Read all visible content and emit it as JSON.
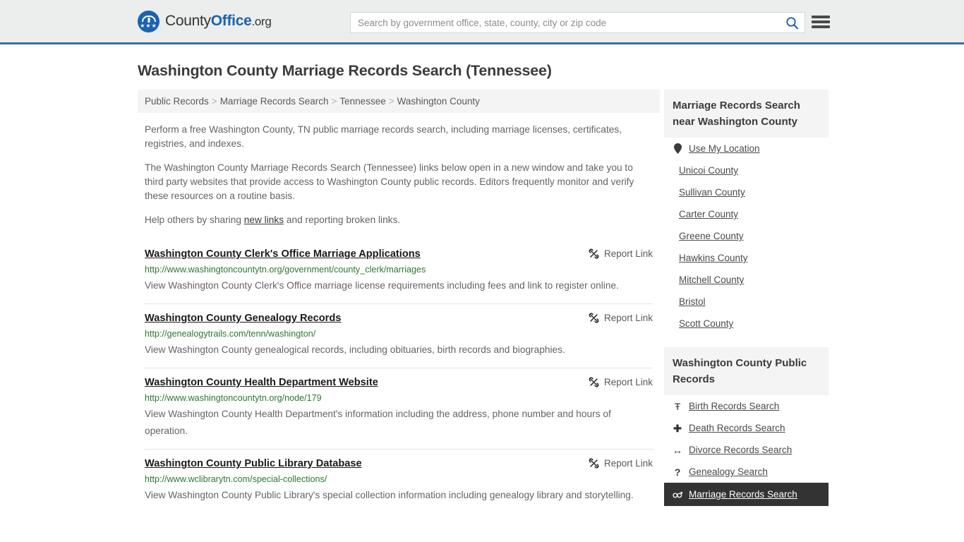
{
  "header": {
    "logo_name_part1": "County",
    "logo_name_part2": "Office",
    "logo_name_part3": ".org",
    "search_placeholder": "Search by government office, state, county, city or zip code",
    "search_value": "",
    "search_icon": "search-icon",
    "menu_icon": "hamburger-menu-icon"
  },
  "page": {
    "title": "Washington County Marriage Records Search (Tennessee)"
  },
  "breadcrumb": {
    "separator": ">",
    "items": [
      {
        "label": "Public Records"
      },
      {
        "label": "Marriage Records Search"
      },
      {
        "label": "Tennessee"
      },
      {
        "label": "Washington County"
      }
    ]
  },
  "intro": {
    "paragraph1": "Perform a free Washington County, TN public marriage records search, including marriage licenses, certificates, registries, and indexes.",
    "paragraph2": "The Washington County Marriage Records Search (Tennessee) links below open in a new window and take you to third party websites that provide access to Washington County public records. Editors frequently monitor and verify these resources on a routine basis.",
    "paragraph3_before": "Help others by sharing ",
    "paragraph3_link": "new links",
    "paragraph3_after": " and reporting broken links."
  },
  "results": {
    "report_label": "Report Link",
    "report_icon": "broken-link-icon",
    "items": [
      {
        "title": "Washington County Clerk's Office Marriage Applications",
        "url": "http://www.washingtoncountytn.org/government/county_clerk/marriages",
        "description": "View Washington County Clerk's Office marriage license requirements including fees and link to register online."
      },
      {
        "title": "Washington County Genealogy Records",
        "url": "http://genealogytrails.com/tenn/washington/",
        "description": "View Washington County genealogical records, including obituaries, birth records and biographies."
      },
      {
        "title": "Washington County Health Department Website",
        "url": "http://www.washingtoncountytn.org/node/179",
        "description": "View Washington County Health Department's information including the address, phone number and hours of operation."
      },
      {
        "title": "Washington County Public Library Database",
        "url": "http://www.wclibrarytn.com/special-collections/",
        "description": "View Washington County Public Library's special collection information including genealogy library and storytelling."
      }
    ]
  },
  "sidebar": {
    "panels": [
      {
        "title": "Marriage Records Search near Washington County",
        "items": [
          {
            "label": "Use My Location",
            "icon": "location-pin-icon",
            "glyph": "•",
            "highlight": false
          },
          {
            "label": "Unicoi County",
            "icon": "",
            "glyph": "",
            "highlight": false
          },
          {
            "label": "Sullivan County",
            "icon": "",
            "glyph": "",
            "highlight": false
          },
          {
            "label": "Carter County",
            "icon": "",
            "glyph": "",
            "highlight": false
          },
          {
            "label": "Greene County",
            "icon": "",
            "glyph": "",
            "highlight": false
          },
          {
            "label": "Hawkins County",
            "icon": "",
            "glyph": "",
            "highlight": false
          },
          {
            "label": "Mitchell County",
            "icon": "",
            "glyph": "",
            "highlight": false
          },
          {
            "label": "Bristol",
            "icon": "",
            "glyph": "",
            "highlight": false
          },
          {
            "label": "Scott County",
            "icon": "",
            "glyph": "",
            "highlight": false
          }
        ]
      },
      {
        "title": "Washington County Public Records",
        "items": [
          {
            "label": "Birth Records Search",
            "icon": "baby-icon",
            "glyph": "Ŧ",
            "highlight": false
          },
          {
            "label": "Death Records Search",
            "icon": "cross-icon",
            "glyph": "✚",
            "highlight": false
          },
          {
            "label": "Divorce Records Search",
            "icon": "split-arrows-icon",
            "glyph": "↔",
            "highlight": false
          },
          {
            "label": "Genealogy Search",
            "icon": "question-mark-icon",
            "glyph": "?",
            "highlight": false
          },
          {
            "label": "Marriage Records Search",
            "icon": "male-female-icon",
            "glyph": "⚥",
            "highlight": true
          }
        ]
      }
    ]
  },
  "colors": {
    "brand_blue": "#1a64af",
    "header_rule": "#3a6f9f",
    "header_bg": "#eceded",
    "panel_bg": "#f4f4f4",
    "url_green": "#2b7a2b",
    "highlight_bg": "#333333"
  }
}
